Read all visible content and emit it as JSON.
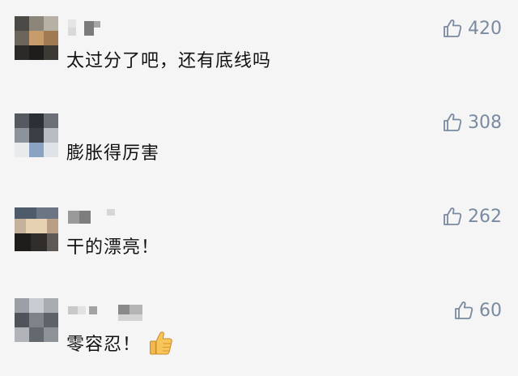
{
  "comments": [
    {
      "text": "太过分了吧，还有底线吗",
      "likes": "420",
      "has_emoji": false
    },
    {
      "text": "膨胀得厉害",
      "likes": "308",
      "has_emoji": false
    },
    {
      "text": "干的漂亮！",
      "likes": "262",
      "has_emoji": false
    },
    {
      "text": "零容忍！",
      "likes": "60",
      "has_emoji": true
    }
  ],
  "icons": {
    "like": "thumbs-up-outline-icon",
    "emoji": "thumbs-up-emoji-icon"
  },
  "colors": {
    "background": "#f5f5f5",
    "text": "#111111",
    "like_count": "#7a8aa0"
  }
}
